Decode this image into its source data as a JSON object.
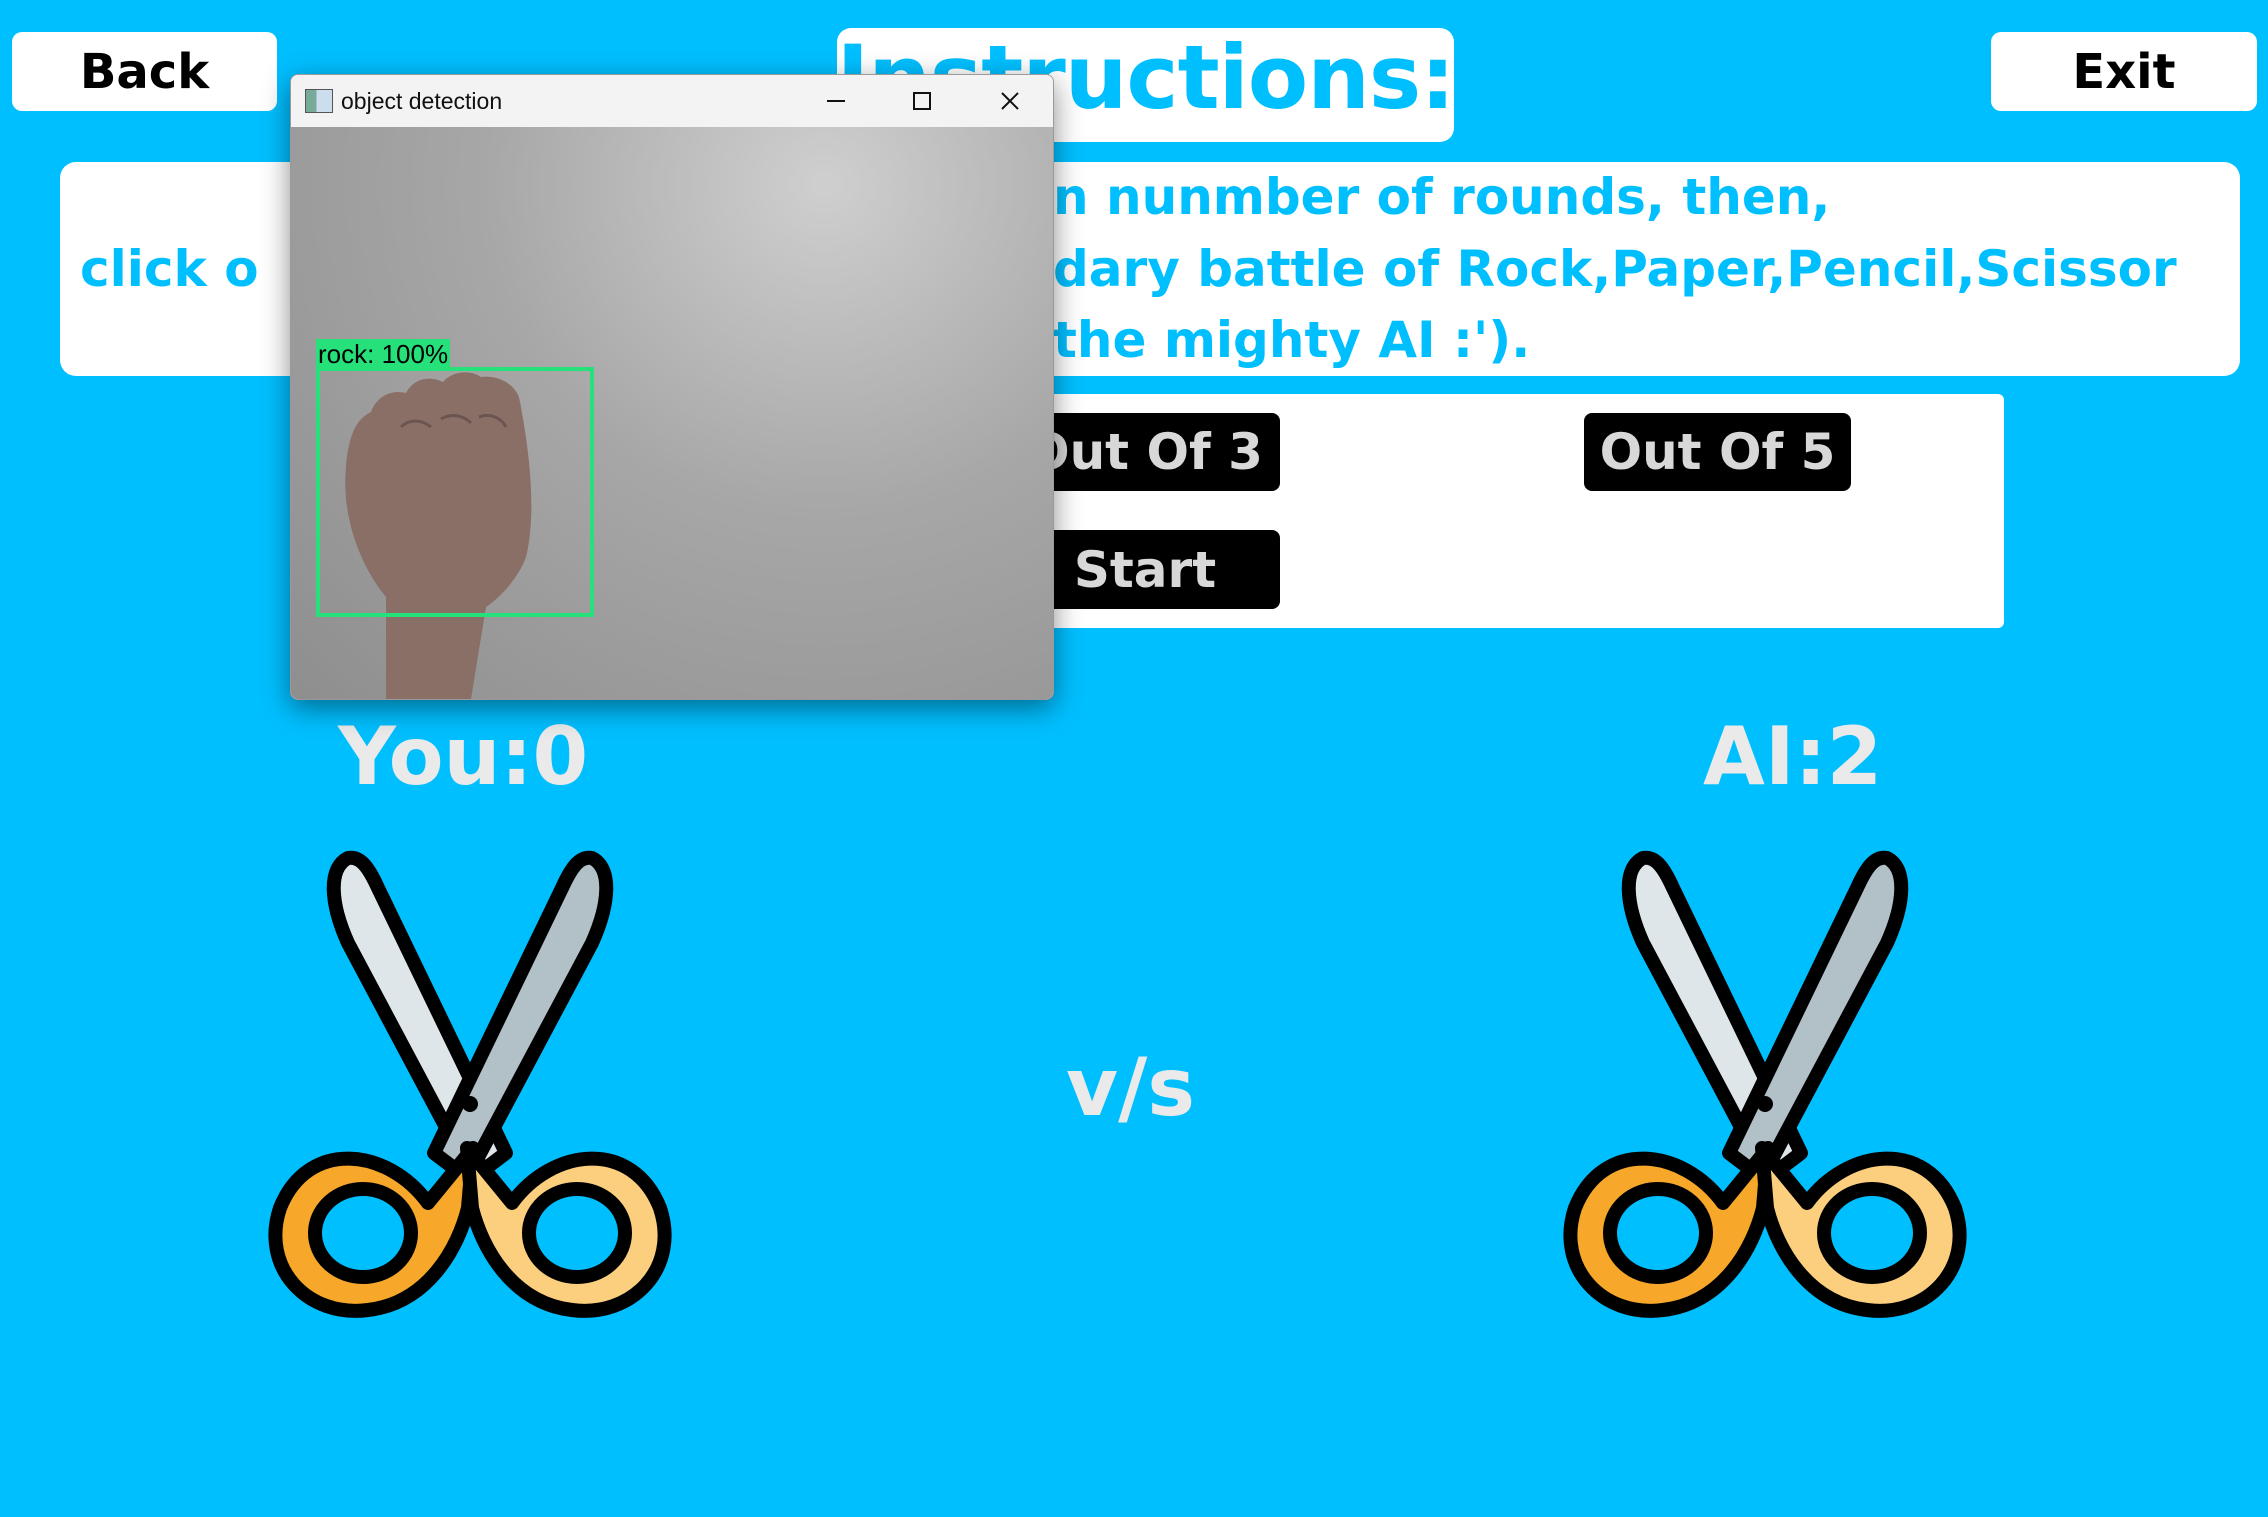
{
  "nav": {
    "back_label": "Back",
    "exit_label": "Exit"
  },
  "title": "Instructions:",
  "instructions": {
    "line1": "n nunmber of rounds, then,",
    "line2_left": "click o",
    "line2_right": "dary battle of Rock,Paper,Pencil,Scissor",
    "line3": "the mighty AI :').",
    "text_color": "#00bfff"
  },
  "rounds": {
    "out3_label": "Out Of 3",
    "out5_label": "Out Of 5",
    "start_label": "Start"
  },
  "scores": {
    "you_label": "You:0",
    "ai_label": "AI:2"
  },
  "vs_label": "v/s",
  "player_choice_icon": "scissors-icon",
  "ai_choice_icon": "scissors-icon",
  "detection_window": {
    "title": "object detection",
    "detection_label": "rock: 100%",
    "box_color": "#26e07a"
  },
  "colors": {
    "background": "#00bfff",
    "button_dark": "#000000",
    "handle": "#f7a72a"
  }
}
